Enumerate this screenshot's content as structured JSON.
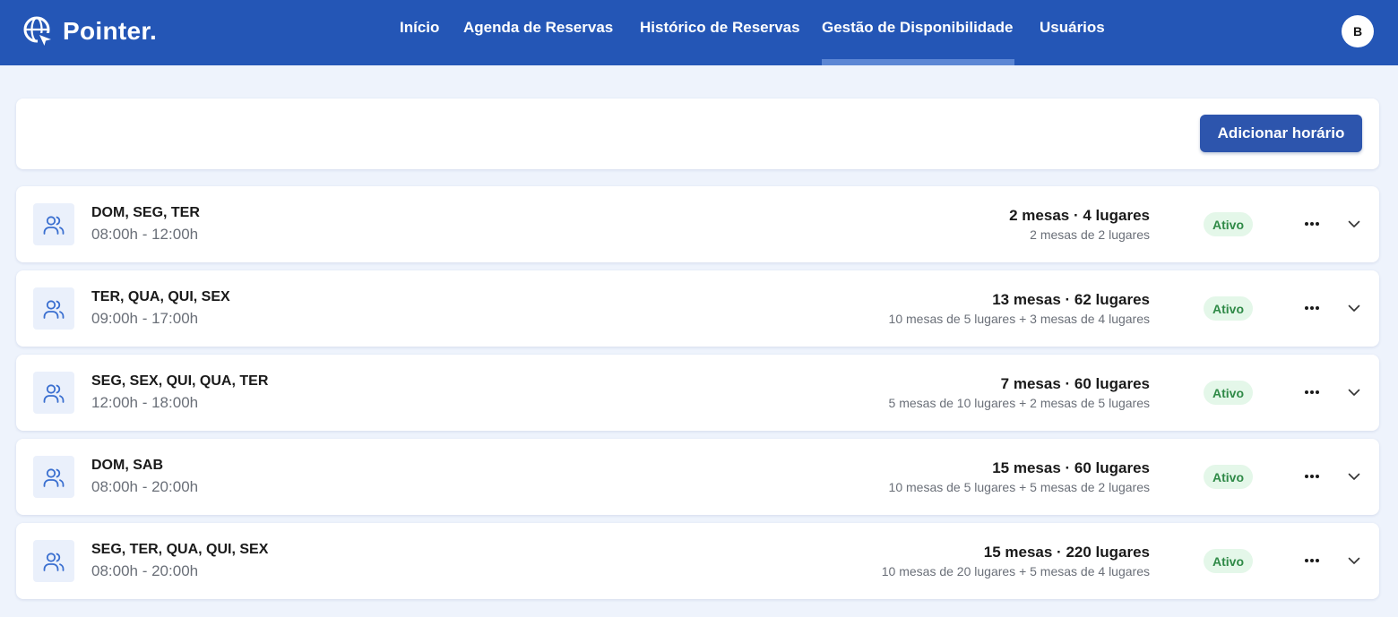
{
  "app": {
    "brand": "Pointer."
  },
  "nav": {
    "items": [
      {
        "label": "Início"
      },
      {
        "label": "Agenda de Reservas"
      },
      {
        "label": "Histórico de Reservas"
      },
      {
        "label": "Gestão de Disponibilidade"
      },
      {
        "label": "Usuários"
      }
    ],
    "active": "Gestão de Disponibilidade"
  },
  "user": {
    "avatar_initial": "B"
  },
  "toolbar": {
    "add_label": "Adicionar horário"
  },
  "colors": {
    "header": "#2456b6",
    "accent_button": "#2d55ad",
    "status_bg": "#e4f7e9",
    "status_text": "#2f8a47",
    "page_bg": "#eef3fc"
  },
  "schedules": [
    {
      "days": "DOM, SEG, TER",
      "time": "08:00h - 12:00h",
      "summary": "2 mesas · 4 lugares",
      "detail": "2 mesas de 2 lugares",
      "status": "Ativo",
      "icon": "users-icon"
    },
    {
      "days": "TER, QUA, QUI, SEX",
      "time": "09:00h - 17:00h",
      "summary": "13 mesas · 62 lugares",
      "detail": "10 mesas de 5 lugares + 3 mesas de 4 lugares",
      "status": "Ativo",
      "icon": "users-icon"
    },
    {
      "days": "SEG, SEX, QUI, QUA, TER",
      "time": "12:00h - 18:00h",
      "summary": "7 mesas · 60 lugares",
      "detail": "5 mesas de 10 lugares + 2 mesas de 5 lugares",
      "status": "Ativo",
      "icon": "users-icon"
    },
    {
      "days": "DOM, SAB",
      "time": "08:00h - 20:00h",
      "summary": "15 mesas · 60 lugares",
      "detail": "10 mesas de 5 lugares + 5 mesas de 2 lugares",
      "status": "Ativo",
      "icon": "users-icon"
    },
    {
      "days": "SEG, TER, QUA, QUI, SEX",
      "time": "08:00h - 20:00h",
      "summary": "15 mesas · 220 lugares",
      "detail": "10 mesas de 20 lugares + 5 mesas de 4 lugares",
      "status": "Ativo",
      "icon": "users-icon"
    }
  ]
}
